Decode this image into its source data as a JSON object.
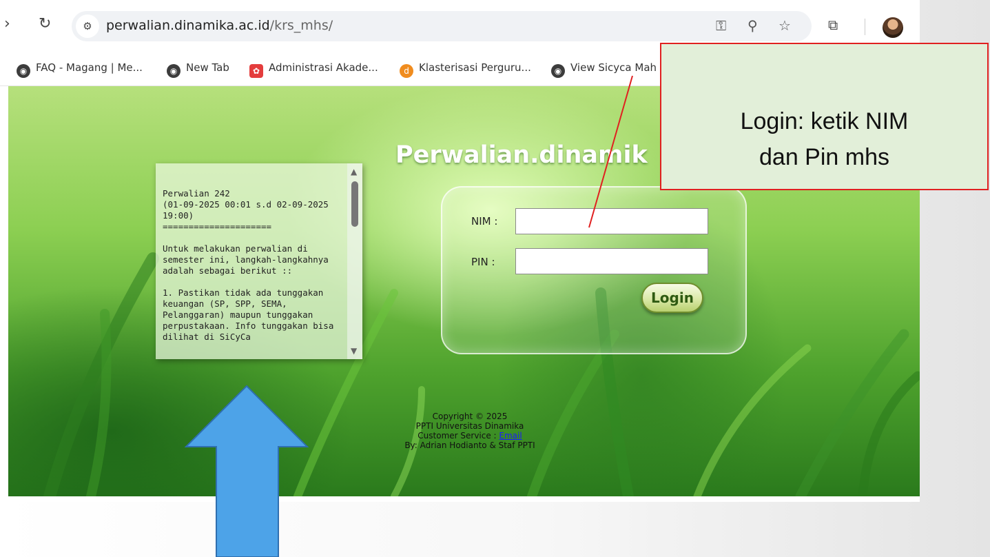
{
  "browser": {
    "url_host": "perwalian.dinamika.ac.id",
    "url_path": "/krs_mhs/",
    "bookmarks": [
      {
        "label": "FAQ - Magang | Me...",
        "icon": "globe-icon"
      },
      {
        "label": "New Tab",
        "icon": "globe-icon"
      },
      {
        "label": "Administrasi Akade...",
        "icon": "puzzle-icon"
      },
      {
        "label": "Klasterisasi Perguru...",
        "icon": "orange-d-icon"
      },
      {
        "label": "View Sicyca Mah",
        "icon": "globe-icon"
      }
    ]
  },
  "page": {
    "title": "Perwalian.dinamik",
    "announcement": "Perwalian 242\n(01-09-2025 00:01 s.d 02-09-2025\n19:00)\n=====================\n\nUntuk melakukan perwalian di\nsemester ini, langkah-langkahnya\nadalah sebagai berikut ::\n\n1. Pastikan tidak ada tunggakan\nkeuangan (SP, SPP, SEMA,\nPelanggaran) maupun tunggakan\nperpustakaan. Info tunggakan bisa\ndilihat di SiCyCa",
    "nim_label": "NIM :",
    "pin_label": "PIN :",
    "nim_value": "",
    "pin_value": "",
    "login_label": "Login",
    "footer": {
      "copyright": "Copyright © 2025",
      "org": "PPTI Universitas Dinamika",
      "cs_prefix": "Customer Service : ",
      "cs_link": "Email",
      "by": "By: Adrian Hodianto & Staf PPTI"
    }
  },
  "annotation": {
    "callout_line1": "Login: ketik NIM",
    "callout_line2": "dan Pin mhs",
    "callout_border_color": "#e02020",
    "callout_bg_color": "#e2efd9",
    "arrow_color": "#4da3e8"
  }
}
